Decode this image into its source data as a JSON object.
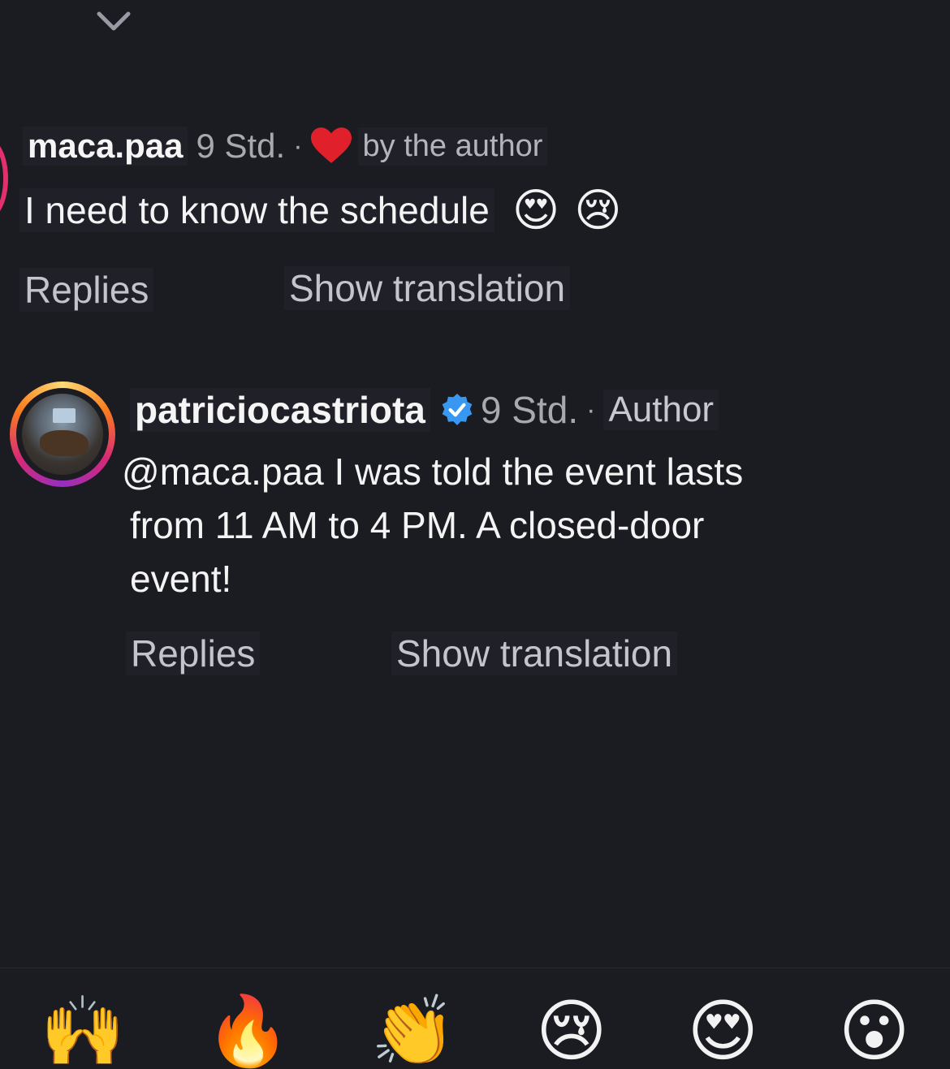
{
  "comment1": {
    "username": "maca.paa",
    "time": "9 Std.",
    "separator": "·",
    "liked_by": "by the author",
    "text": "I need to know the schedule",
    "emojis": [
      "😍",
      "😢"
    ],
    "replies_label": "Replies",
    "translation_label": "Show translation"
  },
  "reply": {
    "username": "patriciocastriota",
    "time": "9 Std.",
    "separator": "·",
    "author_label": "Author",
    "text_line1": "@maca.paa I was told the event lasts",
    "text_line2": "from 11 AM to 4 PM. A closed-door",
    "text_line3": "event!",
    "replies_label": "Replies",
    "translation_label": "Show translation"
  },
  "reaction_bar": [
    "🙌",
    "🔥",
    "👏",
    "😢",
    "😍",
    "😮"
  ],
  "colors": {
    "background": "#1b1b22",
    "heart": "#e0202a",
    "verified": "#3897f0",
    "story_ring": "#e1306c"
  }
}
